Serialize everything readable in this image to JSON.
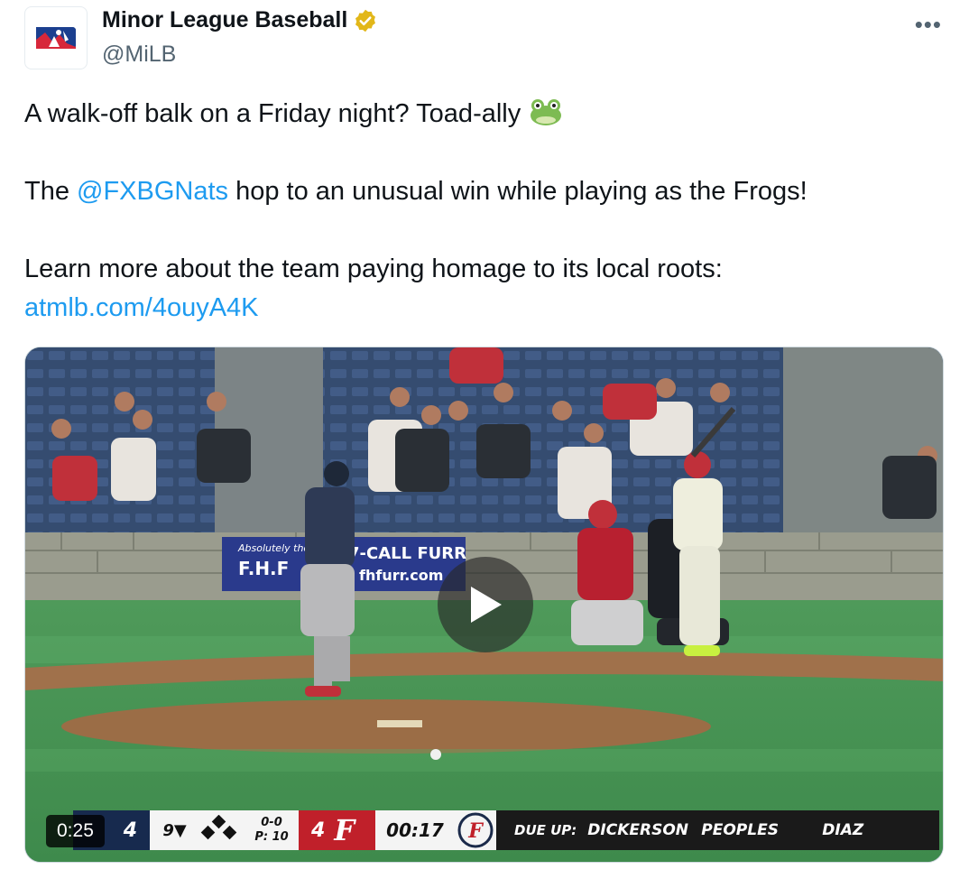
{
  "account": {
    "display_name": "Minor League Baseball",
    "handle": "@MiLB",
    "verified_badge_color": "#e2b719"
  },
  "more_menu_icon": "ellipsis-icon",
  "tweet": {
    "line1": "A walk-off balk on a Friday night? Toad-ally",
    "line1_emoji": "frog-emoji",
    "line2_prefix": "The ",
    "line2_mention": "@FXBGNats",
    "line2_suffix": " hop to an unusual win while playing as the Frogs!",
    "line3": "Learn more about the team paying homage to its local roots:",
    "link": "atmlb.com/4ouyA4K",
    "link_color": "#1d9bf0"
  },
  "video": {
    "duration": "0:25",
    "play_icon": "play-icon",
    "banner_line1": "Absolutely the",
    "banner_line2": "F.H.F",
    "banner_phone": "7-CALL FURR",
    "banner_site": "fhfurr.com",
    "scorebug": {
      "away_score": "4",
      "inning": "9▼",
      "count": "0-0",
      "pitches": "P: 10",
      "home_score": "4",
      "home_letter": "F",
      "clock": "00:17",
      "due_up_label": "DUE UP:",
      "batters": [
        "DICKERSON",
        "PEOPLES",
        "DIAZ"
      ],
      "away_color": "#172a4e",
      "home_color": "#c0202a"
    }
  }
}
